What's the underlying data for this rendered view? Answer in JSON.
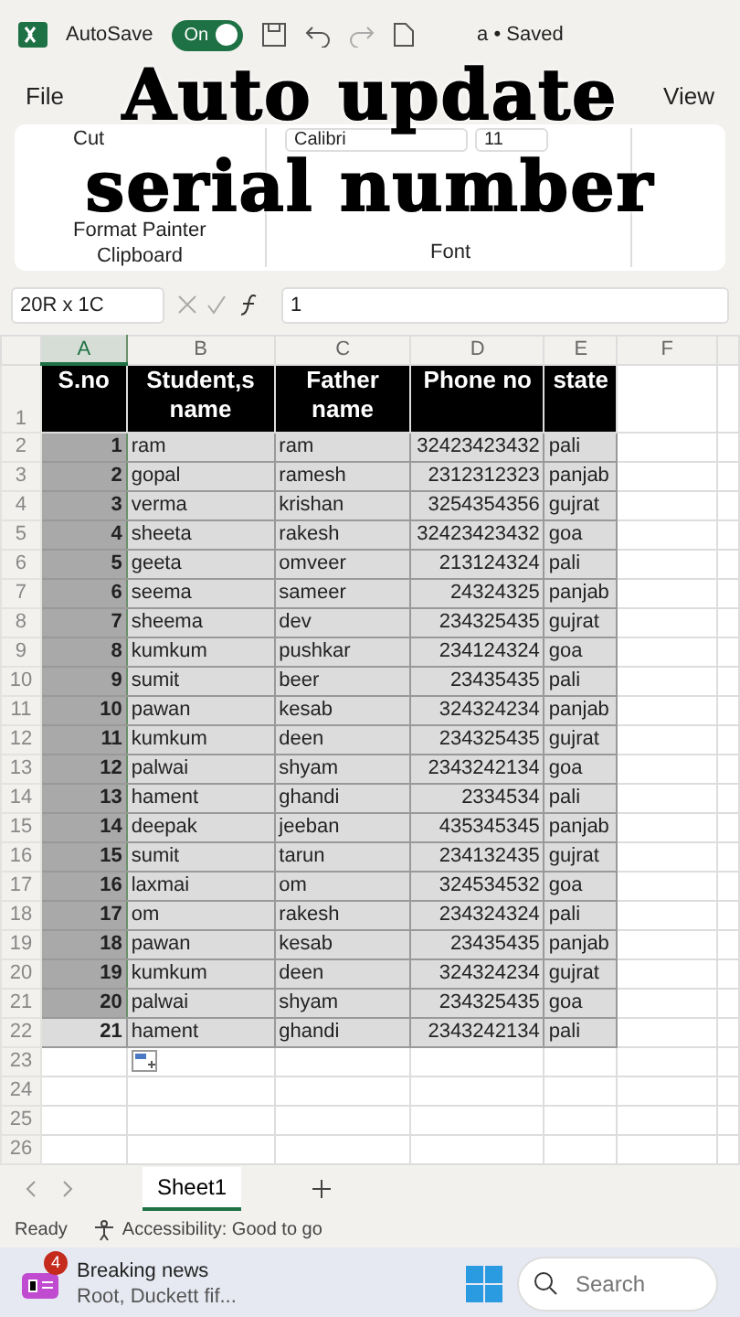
{
  "overlay_title": [
    "Auto update",
    "serial number"
  ],
  "title_bar": {
    "autosave_label": "AutoSave",
    "autosave": {
      "label": "On",
      "on": true
    },
    "document": "a • Saved"
  },
  "ribbon_tabs": [
    "File",
    "View"
  ],
  "ribbon": {
    "clipboard": {
      "items": [
        "Cut",
        "Format Painter"
      ],
      "group": "Clipboard"
    },
    "font": {
      "name": "Calibri",
      "size": "11",
      "group": "Font"
    }
  },
  "formula_bar": {
    "name_box": "20R x 1C",
    "value": "1"
  },
  "sheet": {
    "columns": [
      {
        "label": "A",
        "selected": true
      },
      {
        "label": "B",
        "selected": false
      },
      {
        "label": "C",
        "selected": false
      },
      {
        "label": "D",
        "selected": false
      },
      {
        "label": "E",
        "selected": false
      },
      {
        "label": "F",
        "selected": false
      }
    ],
    "header_row": {
      "n": "1",
      "cells": [
        "S.no",
        "Student,s name",
        "Father name",
        "Phone no",
        "state"
      ]
    },
    "rows": [
      {
        "n": "2",
        "selected": true,
        "cells": [
          "1",
          "ram",
          "ram",
          "32423423432",
          "pali"
        ]
      },
      {
        "n": "3",
        "selected": true,
        "cells": [
          "2",
          "gopal",
          "ramesh",
          "2312312323",
          "panjab"
        ]
      },
      {
        "n": "4",
        "selected": true,
        "cells": [
          "3",
          "verma",
          "krishan",
          "3254354356",
          "gujrat"
        ]
      },
      {
        "n": "5",
        "selected": true,
        "cells": [
          "4",
          "sheeta",
          "rakesh",
          "32423423432",
          "goa"
        ]
      },
      {
        "n": "6",
        "selected": true,
        "cells": [
          "5",
          "geeta",
          "omveer",
          "213124324",
          "pali"
        ]
      },
      {
        "n": "7",
        "selected": true,
        "cells": [
          "6",
          "seema",
          "sameer",
          "24324325",
          "panjab"
        ]
      },
      {
        "n": "8",
        "selected": true,
        "cells": [
          "7",
          "sheema",
          "dev",
          "234325435",
          "gujrat"
        ]
      },
      {
        "n": "9",
        "selected": true,
        "cells": [
          "8",
          "kumkum",
          "pushkar",
          "234124324",
          "goa"
        ]
      },
      {
        "n": "10",
        "selected": true,
        "cells": [
          "9",
          "sumit",
          "beer",
          "23435435",
          "pali"
        ]
      },
      {
        "n": "11",
        "selected": true,
        "cells": [
          "10",
          "pawan",
          "kesab",
          "324324234",
          "panjab"
        ]
      },
      {
        "n": "12",
        "selected": true,
        "cells": [
          "11",
          "kumkum",
          "deen",
          "234325435",
          "gujrat"
        ]
      },
      {
        "n": "13",
        "selected": true,
        "cells": [
          "12",
          "palwai",
          "shyam",
          "2343242134",
          "goa"
        ]
      },
      {
        "n": "14",
        "selected": true,
        "cells": [
          "13",
          "hament",
          "ghandi",
          "2334534",
          "pali"
        ]
      },
      {
        "n": "15",
        "selected": true,
        "cells": [
          "14",
          "deepak",
          "jeeban",
          "435345345",
          "panjab"
        ]
      },
      {
        "n": "16",
        "selected": true,
        "cells": [
          "15",
          "sumit",
          "tarun",
          "234132435",
          "gujrat"
        ]
      },
      {
        "n": "17",
        "selected": true,
        "cells": [
          "16",
          "laxmai",
          "om",
          "324534532",
          "goa"
        ]
      },
      {
        "n": "18",
        "selected": true,
        "cells": [
          "17",
          "om",
          "rakesh",
          "234324324",
          "pali"
        ]
      },
      {
        "n": "19",
        "selected": true,
        "cells": [
          "18",
          "pawan",
          "kesab",
          "23435435",
          "panjab"
        ]
      },
      {
        "n": "20",
        "selected": true,
        "cells": [
          "19",
          "kumkum",
          "deen",
          "324324234",
          "gujrat"
        ]
      },
      {
        "n": "21",
        "selected": true,
        "cells": [
          "20",
          "palwai",
          "shyam",
          "234325435",
          "goa"
        ]
      },
      {
        "n": "22",
        "selected": false,
        "cells": [
          "21",
          "hament",
          "ghandi",
          "2343242134",
          "pali"
        ]
      }
    ],
    "empty_rows": [
      "23",
      "24",
      "25",
      "26"
    ]
  },
  "sheet_tabs": [
    {
      "label": "Sheet1",
      "selected": true
    }
  ],
  "status_bar": {
    "state": "Ready",
    "accessibility": "Accessibility: Good to go"
  },
  "taskbar": {
    "news_badge": "4",
    "news_title": "Breaking news",
    "news_text": "Root, Duckett fif...",
    "search_placeholder": "Search"
  }
}
